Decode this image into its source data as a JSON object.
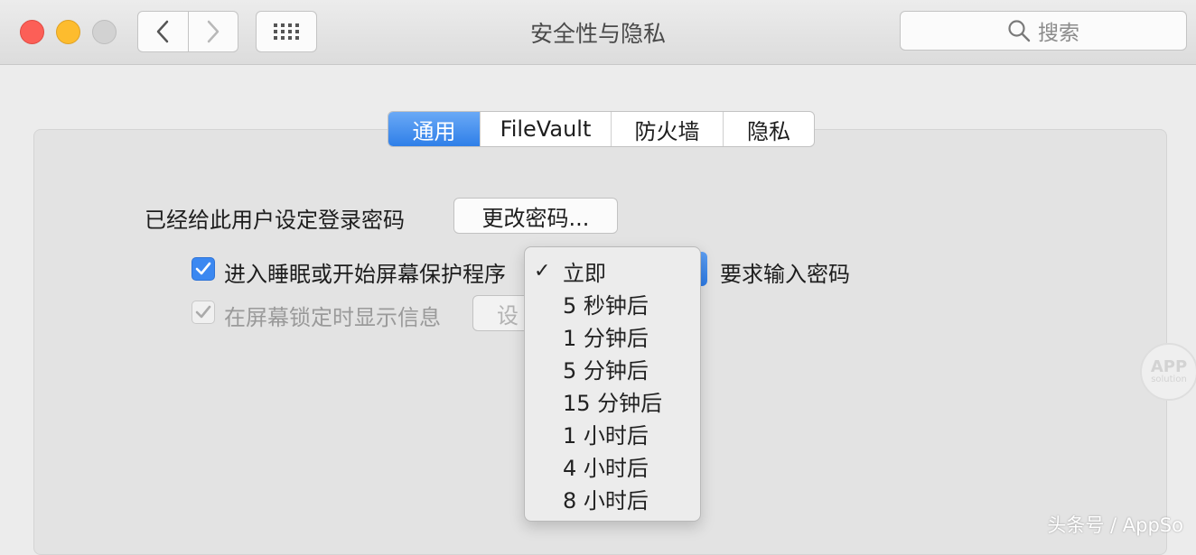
{
  "window": {
    "title": "安全性与隐私",
    "search_placeholder": "搜索"
  },
  "tabs": [
    {
      "label": "通用",
      "active": true
    },
    {
      "label": "FileVault",
      "active": false
    },
    {
      "label": "防火墙",
      "active": false
    },
    {
      "label": "隐私",
      "active": false
    }
  ],
  "general": {
    "password_set_label": "已经给此用户设定登录密码",
    "change_password_button": "更改密码...",
    "require_password_label": "进入睡眠或开始屏幕保护程序",
    "require_password_checked": true,
    "require_password_suffix": "要求输入密码",
    "show_message_label": "在屏幕锁定时显示信息",
    "show_message_checked": true,
    "set_button_partial": "设"
  },
  "dropdown": {
    "selected": "立即",
    "options": [
      "立即",
      "5 秒钟后",
      "1 分钟后",
      "5 分钟后",
      "15 分钟后",
      "1 小时后",
      "4 小时后",
      "8 小时后"
    ]
  },
  "watermark": {
    "badge_main": "APP",
    "badge_sub": "solution",
    "credit": "头条号 / AppSo"
  },
  "colors": {
    "accent": "#3b88f1",
    "close": "#fc5f57",
    "minimize": "#fdbc2e",
    "zoom_disabled": "#d2d2d2"
  }
}
